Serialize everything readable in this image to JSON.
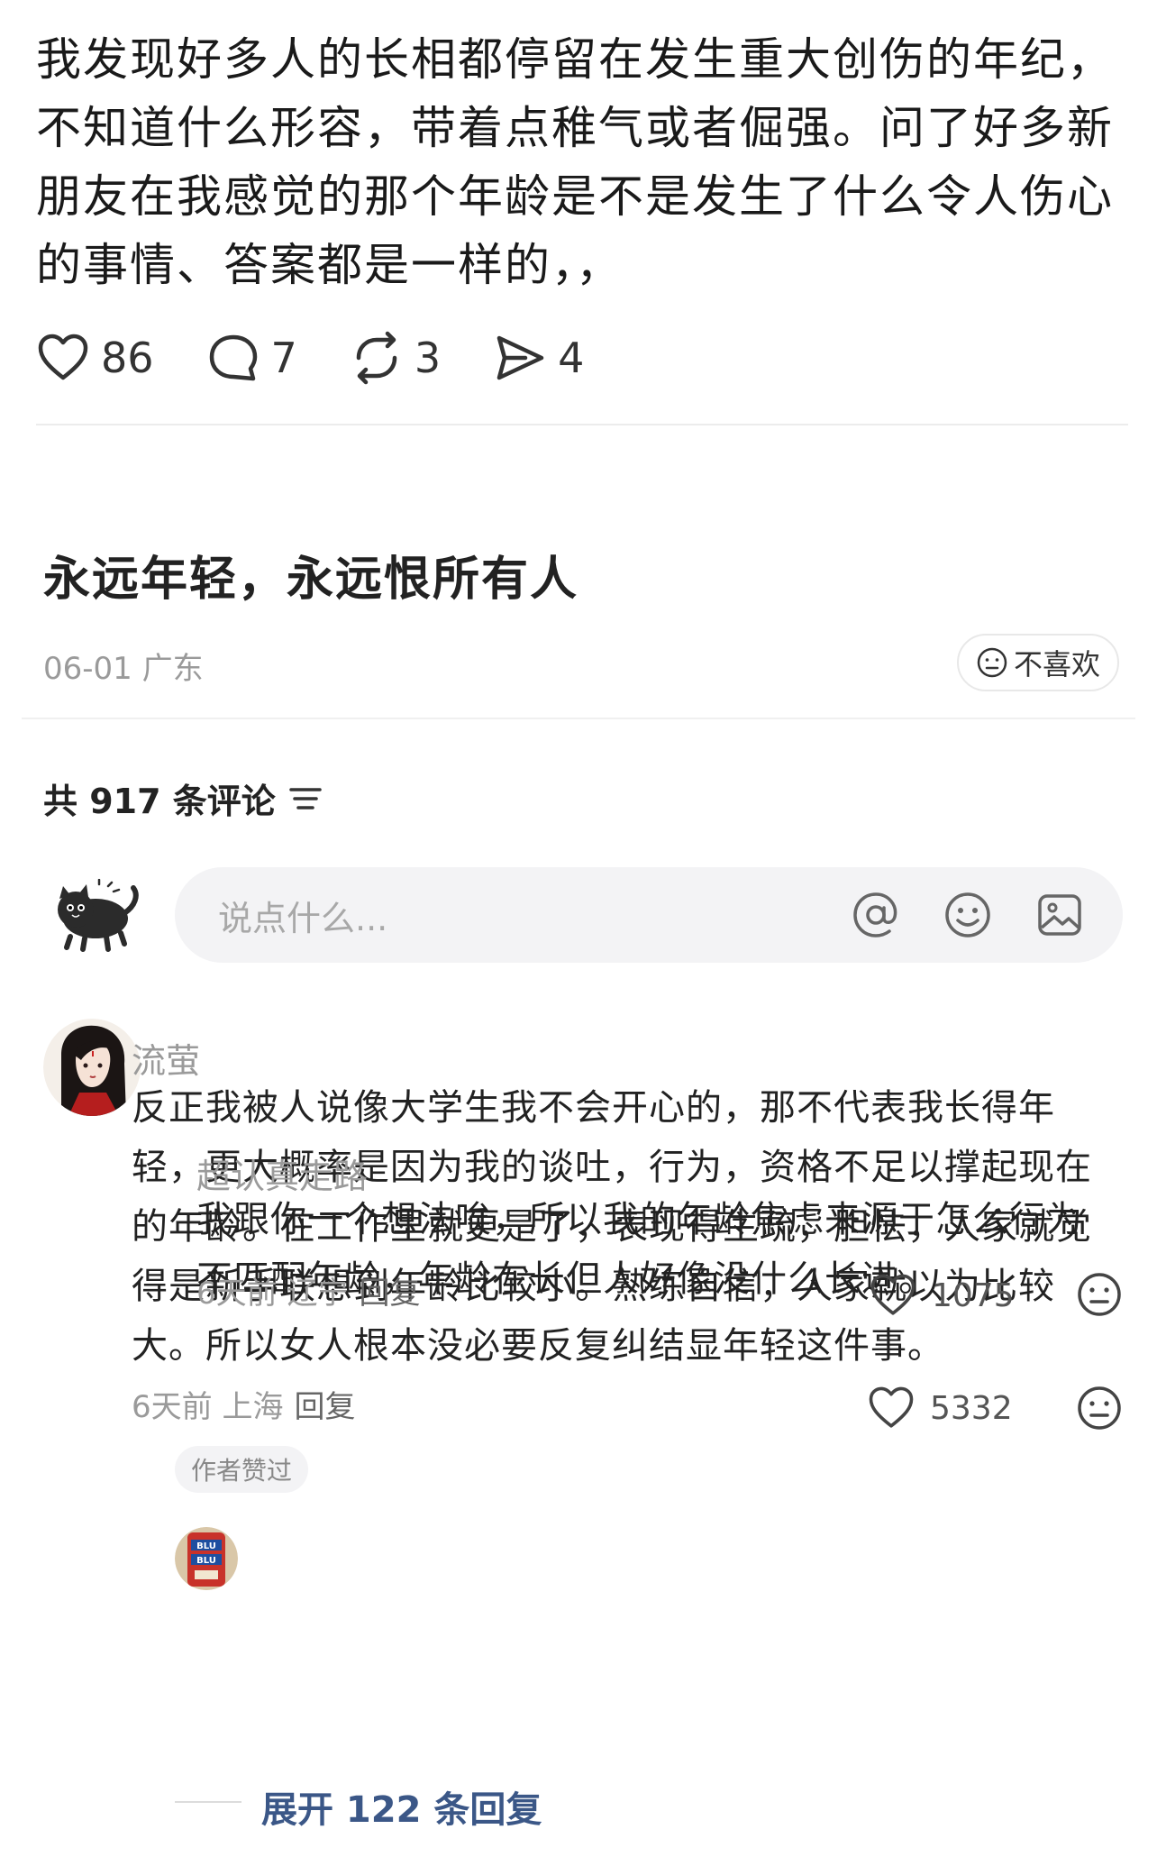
{
  "post": {
    "text": "我发现好多人的长相都停留在发生重大创伤的年纪，不知道什么形容，带着点稚气或者倔强。问了好多新朋友在我感觉的那个年龄是不是发生了什么令人伤心的事情、答案都是一样的，，",
    "likes": "86",
    "comments": "7",
    "reposts": "3",
    "shares": "4"
  },
  "article": {
    "title": "永远年轻，永远恨所有人",
    "meta": "06-01 广东",
    "dislike_label": "不喜欢"
  },
  "comments_section": {
    "header": "共 917 条评论",
    "input_placeholder": "说点什么..."
  },
  "comments": [
    {
      "username": "流萤",
      "text": "反正我被人说像大学生我不会开心的，那不代表我长得年轻，更大概率是因为我的谈吐，行为，资格不足以撑起现在的年龄。在工作里就更是了，表现得生疏，胆怯，人家就觉得是新手联想到年龄比较小。熟练自信，人家就以为比较大。所以女人根本没必要反复纠结显年轻这件事。",
      "time_location": "6天前 上海",
      "reply_label": "回复",
      "likes": "5332",
      "badge": "作者赞过",
      "replies": [
        {
          "username": "超认真走路",
          "text": "我跟你一个想法唉，所以我的年龄焦虑来源于怎么行为不匹配年龄，年龄在长但人好像没什么长进。",
          "time_location": "6天前 辽宁",
          "reply_label": "回复",
          "likes": "1075"
        }
      ],
      "expand_label": "展开 122 条回复"
    }
  ],
  "colors": {
    "link": "#3b5787",
    "muted": "#9a9a9a",
    "input_bg": "#f3f3f5"
  },
  "icons": [
    "heart-icon",
    "comment-icon",
    "repost-icon",
    "share-icon",
    "neutral-face-icon",
    "filter-icon",
    "at-icon",
    "emoji-icon",
    "image-icon"
  ]
}
